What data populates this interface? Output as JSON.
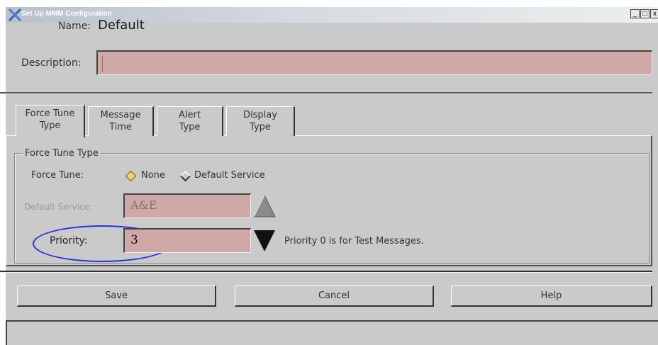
{
  "window": {
    "title": "Set Up MMM Configuration",
    "controls": [
      "_",
      "□",
      "x"
    ]
  },
  "header": {
    "name_label": "Name:",
    "name_value": "Default",
    "description_label": "Description:",
    "description_value": ""
  },
  "tabs": [
    {
      "line1": "Force Tune",
      "line2": "Type",
      "active": true
    },
    {
      "line1": "Message",
      "line2": "Time",
      "active": false
    },
    {
      "line1": "Alert",
      "line2": "Type",
      "active": false
    },
    {
      "line1": "Display",
      "line2": "Type",
      "active": false
    }
  ],
  "force_tune": {
    "group_title": "Force Tune Type",
    "force_tune_label": "Force Tune:",
    "options": [
      {
        "label": "None",
        "selected": true
      },
      {
        "label": "Default Service",
        "selected": false
      }
    ],
    "default_service_label": "Default Service:",
    "default_service_value": "A&E",
    "priority_label": "Priority:",
    "priority_value": "3",
    "priority_note": "Priority 0 is for Test Messages."
  },
  "buttons": {
    "save": "Save",
    "cancel": "Cancel",
    "help": "Help"
  },
  "status_text": "",
  "colors": {
    "field_bg": "#cfa8a8",
    "window_bg": "#cacaca",
    "highlight_ellipse": "#2b33d6",
    "selected_radio": "#f4d94c"
  },
  "icons": {
    "app": "x-logo-icon",
    "up": "triangle-up-icon",
    "down": "triangle-down-icon"
  }
}
